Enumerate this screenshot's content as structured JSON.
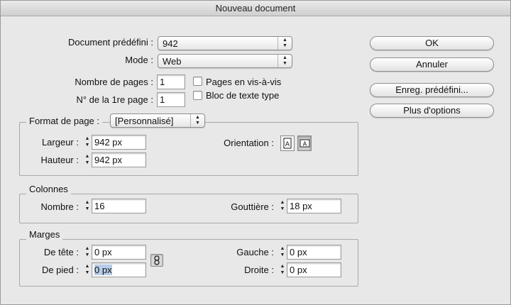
{
  "window": {
    "title": "Nouveau document"
  },
  "doc": {
    "preset_label": "Document prédéfini :",
    "preset_value": "942",
    "mode_label": "Mode :",
    "mode_value": "Web",
    "pages_label": "Nombre de pages :",
    "pages_value": "1",
    "first_page_label": "N° de la 1re page :",
    "first_page_value": "1",
    "facing_label": "Pages en vis-à-vis",
    "facing_checked": false,
    "textframe_label": "Bloc de texte type",
    "textframe_checked": false
  },
  "format": {
    "title_label": "Format de page :",
    "title_value": "[Personnalisé]",
    "width_label": "Largeur :",
    "width_value": "942 px",
    "height_label": "Hauteur :",
    "height_value": "942 px",
    "orientation_label": "Orientation :",
    "orientation_selected": "landscape"
  },
  "columns": {
    "title": "Colonnes",
    "number_label": "Nombre :",
    "number_value": "16",
    "gutter_label": "Gouttière :",
    "gutter_value": "18 px"
  },
  "margins": {
    "title": "Marges",
    "top_label": "De tête :",
    "top_value": "0 px",
    "bottom_label": "De pied :",
    "bottom_value": "0 px",
    "left_label": "Gauche :",
    "left_value": "0 px",
    "right_label": "Droite :",
    "right_value": "0 px"
  },
  "buttons": {
    "ok": "OK",
    "cancel": "Annuler",
    "save_preset": "Enreg. prédéfini...",
    "more_options": "Plus d'options"
  }
}
